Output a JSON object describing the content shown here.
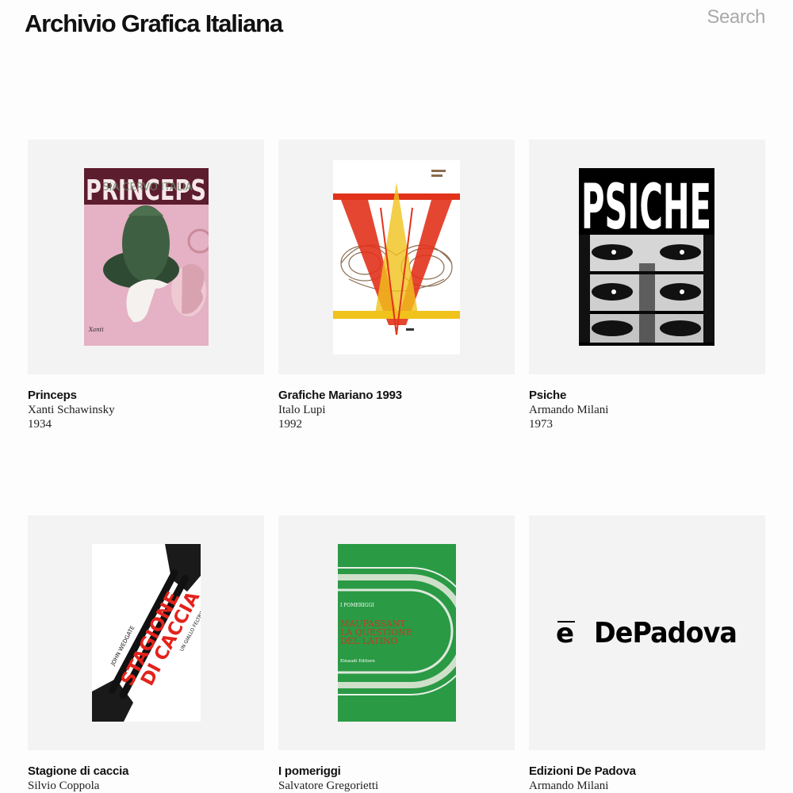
{
  "header": {
    "title": "Archivio Grafica Italiana",
    "search_label": "Search"
  },
  "items": [
    {
      "title": "Princeps",
      "designer": "Xanti Schawinsky",
      "year": "1934",
      "poster": {
        "headline": "PRINCEPS",
        "subline": "SIA CERVO ITALIA",
        "signature": "Xanti",
        "colors": [
          "#e3aec3",
          "#3e5a40",
          "#5a1b2c"
        ]
      }
    },
    {
      "title": "Grafiche Mariano 1993",
      "designer": "Italo Lupi",
      "year": "1992",
      "poster": {
        "colors": [
          "#e2321b",
          "#f0c21c",
          "#8b6c4f"
        ]
      }
    },
    {
      "title": "Psiche",
      "designer": "Armando Milani",
      "year": "1973",
      "poster": {
        "headline": "PSICHE",
        "colors": [
          "#000000",
          "#ffffff"
        ]
      }
    },
    {
      "title": "Stagione di caccia",
      "designer": "Silvio Coppola",
      "year": "",
      "poster": {
        "author": "JOHN WEDGATE",
        "headline_1": "STAGIONE",
        "headline_2": "DI CACCIA",
        "imprint": "UN GIALLO FELTRINELLI",
        "colors": [
          "#e4221b",
          "#111111"
        ]
      }
    },
    {
      "title": "I pomeriggi",
      "designer": "Salvatore Gregorietti",
      "year": "",
      "poster": {
        "series": "I POMERIGGI",
        "headline_1": "MAUPASSANT",
        "headline_2": "LA QUESTIONE",
        "headline_3": "DEL LATINO",
        "publisher": "Einaudi Editore",
        "colors": [
          "#2a9a45",
          "#c43a22"
        ]
      }
    },
    {
      "title": "Edizioni De Padova",
      "designer": "Armando Milani",
      "year": "",
      "poster": {
        "mark": "e",
        "wordmark": "DePadova"
      }
    }
  ]
}
